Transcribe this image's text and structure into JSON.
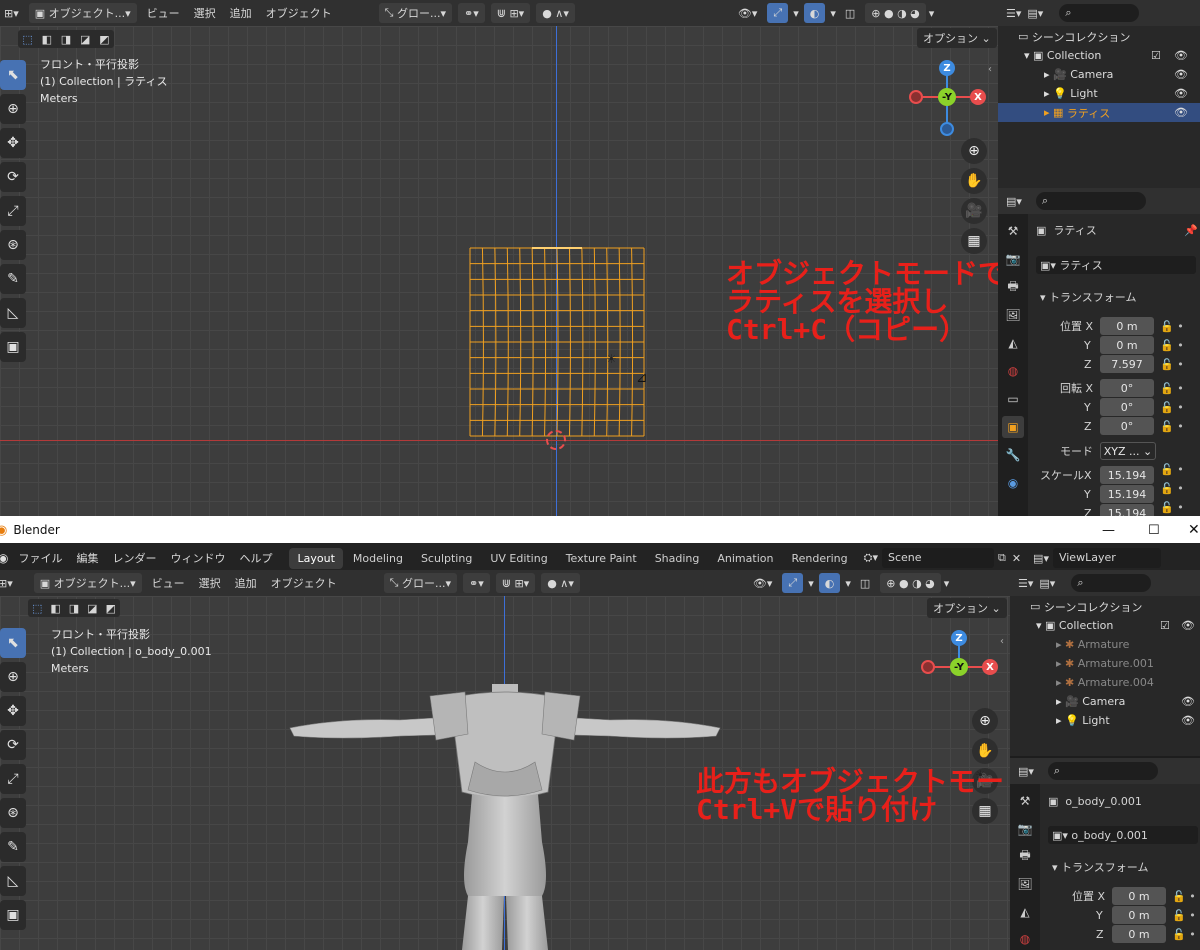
{
  "top": {
    "header": {
      "mode_label": "オブジェクト...",
      "menus": [
        "ビュー",
        "選択",
        "追加",
        "オブジェクト"
      ],
      "transform_orientation": "グロー...",
      "options_label": "オプション"
    },
    "viewport_info": {
      "line1": "フロント・平行投影",
      "line2": "(1) Collection | ラティス",
      "line3": "Meters"
    },
    "outliner": {
      "scene_collection": "シーンコレクション",
      "collection": "Collection",
      "items": [
        "Camera",
        "Light",
        "ラティス"
      ]
    },
    "properties": {
      "object_name": "ラティス",
      "data_name": "ラティス",
      "panel_title": "トランスフォーム",
      "location_label": "位置",
      "rotation_label": "回転",
      "mode_label": "モード",
      "mode_value": "XYZ ...",
      "scale_label": "スケール",
      "location": {
        "x": "0 m",
        "y": "0 m",
        "z": "7.597"
      },
      "rotation": {
        "x": "0°",
        "y": "0°",
        "z": "0°"
      },
      "scale": {
        "x": "15.194",
        "y": "15.194",
        "z": "15.194"
      },
      "axis_x": "X",
      "axis_y": "Y",
      "axis_z": "Z"
    },
    "annotation": "オブジェクトモードで\nラティスを選択し\nCtrl+C（コピー）"
  },
  "window": {
    "title": "Blender",
    "menus": [
      "ファイル",
      "編集",
      "レンダー",
      "ウィンドウ",
      "ヘルプ"
    ],
    "workspaces": [
      "Layout",
      "Modeling",
      "Sculpting",
      "UV Editing",
      "Texture Paint",
      "Shading",
      "Animation",
      "Rendering"
    ],
    "scene": "Scene",
    "view_layer": "ViewLayer"
  },
  "bottom": {
    "header": {
      "mode_label": "オブジェクト...",
      "menus": [
        "ビュー",
        "選択",
        "追加",
        "オブジェクト"
      ],
      "transform_orientation": "グロー...",
      "options_label": "オプション"
    },
    "viewport_info": {
      "line1": "フロント・平行投影",
      "line2": "(1) Collection | o_body_0.001",
      "line3": "Meters"
    },
    "outliner": {
      "scene_collection": "シーンコレクション",
      "collection": "Collection",
      "items": [
        "Armature",
        "Armature.001",
        "Armature.004",
        "Camera",
        "Light"
      ]
    },
    "properties": {
      "object_name": "o_body_0.001",
      "data_name": "o_body_0.001",
      "panel_title": "トランスフォーム",
      "location_label": "位置",
      "location": {
        "x": "0 m",
        "y": "0 m",
        "z": "0 m"
      },
      "axis_x": "X",
      "axis_y": "Y",
      "axis_z": "Z"
    },
    "annotation": "此方もオブジェクトモードで\nCtrl+Vで貼り付け"
  },
  "gizmo": {
    "z": "Z",
    "y": "-Y",
    "x": "X"
  },
  "colors": {
    "accent": "#4772b3",
    "lattice": "#f0a020",
    "annotation": "#e8201a",
    "x_axis": "#e84d4d",
    "y_axis": "#8bd22a",
    "z_axis": "#3d8be0"
  }
}
